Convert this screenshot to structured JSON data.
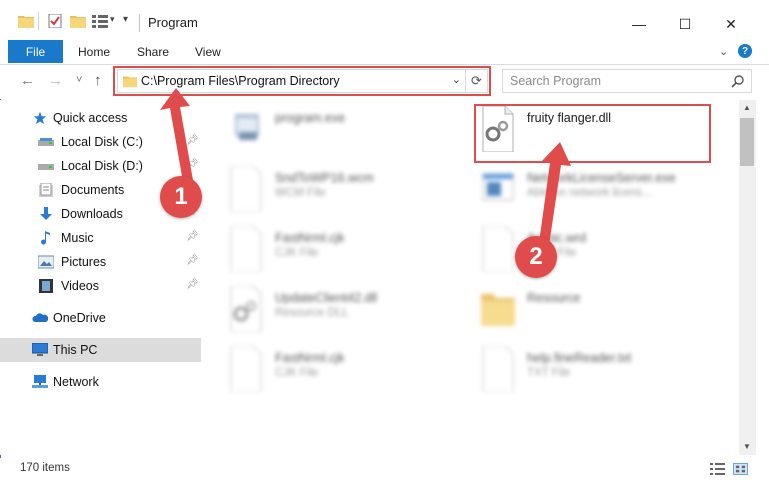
{
  "window": {
    "title": "Program",
    "controls": {
      "minimize": "—",
      "maximize": "☐",
      "close": "✕"
    }
  },
  "ribbon": {
    "tabs": [
      {
        "label": "File",
        "active": true
      },
      {
        "label": "Home"
      },
      {
        "label": "Share"
      },
      {
        "label": "View"
      }
    ],
    "help": "?"
  },
  "nav": {
    "back": "←",
    "forward": "→",
    "recent": "˅",
    "up": "↑",
    "address": "C:\\Program Files\\Program Directory",
    "search_placeholder": "Search Program"
  },
  "sidebar": {
    "items": [
      {
        "label": "Quick access",
        "icon": "star-icon",
        "pinned": false
      },
      {
        "label": "Local Disk (C:)",
        "icon": "drive-icon",
        "pinned": true
      },
      {
        "label": "Local Disk (D:)",
        "icon": "drive-icon",
        "pinned": true
      },
      {
        "label": "Documents",
        "icon": "documents-icon",
        "pinned": true
      },
      {
        "label": "Downloads",
        "icon": "downloads-icon",
        "pinned": true
      },
      {
        "label": "Music",
        "icon": "music-icon",
        "pinned": true
      },
      {
        "label": "Pictures",
        "icon": "pictures-icon",
        "pinned": true
      },
      {
        "label": "Videos",
        "icon": "videos-icon",
        "pinned": true
      },
      {
        "label": "OneDrive",
        "icon": "onedrive-icon",
        "pinned": false
      },
      {
        "label": "This PC",
        "icon": "computer-icon",
        "pinned": false,
        "selected": true
      },
      {
        "label": "Network",
        "icon": "network-icon",
        "pinned": false
      }
    ]
  },
  "files": [
    {
      "name": "program.exe",
      "type": "",
      "icon": "exe-icon",
      "blurred": true
    },
    {
      "name": "fruity flanger.dll",
      "type": "",
      "icon": "dll-gear-icon",
      "blurred": false
    },
    {
      "name": "SndToWP16.wcm",
      "type": "WCM File",
      "icon": "file-icon",
      "blurred": true
    },
    {
      "name": "NetworkLicenseServer.exe",
      "type": "Ableton network licens...",
      "icon": "app-window-icon",
      "blurred": true
    },
    {
      "name": "FastNrml.cjk",
      "type": "CJK File",
      "icon": "file-icon",
      "blurred": true
    },
    {
      "name": "Arabic.wrd",
      "type": "WRD File",
      "icon": "file-icon",
      "blurred": true
    },
    {
      "name": "UpdateClient42.dll",
      "type": "Resource DLL",
      "icon": "dll-gear-icon",
      "blurred": true
    },
    {
      "name": "Resource",
      "type": "",
      "icon": "folder-icon",
      "blurred": true
    },
    {
      "name": "FastNrml.cjk",
      "type": "CJK File",
      "icon": "file-icon",
      "blurred": true
    },
    {
      "name": "help.fineReader.txt",
      "type": "TXT File",
      "icon": "file-icon",
      "blurred": true
    }
  ],
  "status": {
    "items_count": "170 items"
  },
  "annotations": {
    "badge1": "1",
    "badge2": "2"
  },
  "colors": {
    "accent": "#1979ca",
    "annotation": "#e04b4b",
    "selected": "#d9d9d9"
  }
}
